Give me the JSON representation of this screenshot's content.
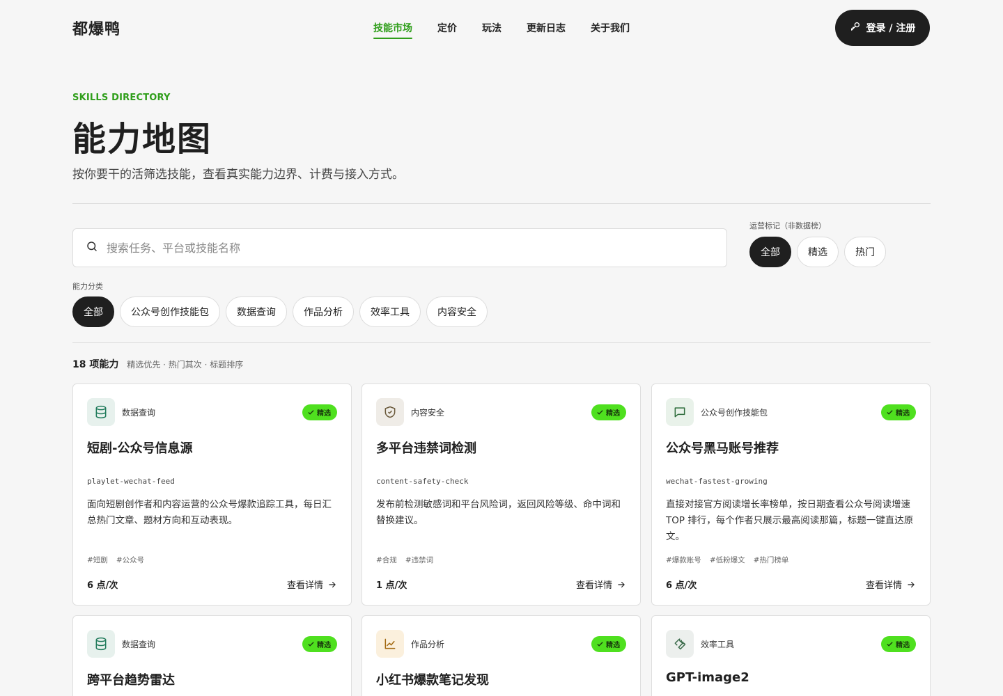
{
  "brand": {
    "logo": "都爆鸭",
    "accent": "#2f9e1a",
    "badge_color": "#4fe01f"
  },
  "nav": {
    "items": [
      {
        "label": "技能市场",
        "active": true
      },
      {
        "label": "定价"
      },
      {
        "label": "玩法"
      },
      {
        "label": "更新日志"
      },
      {
        "label": "关于我们"
      }
    ],
    "login_label": "登录 / 注册",
    "login_icon": "key-icon"
  },
  "hero": {
    "eyebrow": "SKILLS DIRECTORY",
    "title": "能力地图",
    "subtitle": "按你要干的活筛选技能，查看真实能力边界、计费与接入方式。"
  },
  "search": {
    "placeholder": "搜索任务、平台或技能名称",
    "value": ""
  },
  "ops_filter": {
    "label": "运营标记（非数据榜）",
    "options": [
      "全部",
      "精选",
      "热门"
    ],
    "selected": "全部"
  },
  "category_filter": {
    "label": "能力分类",
    "options": [
      "全部",
      "公众号创作技能包",
      "数据查询",
      "作品分析",
      "效率工具",
      "内容安全"
    ],
    "selected": "全部"
  },
  "results": {
    "count": "18 项能力",
    "sort_note": "精选优先 · 热门其次 · 标题排序"
  },
  "cards": [
    {
      "icon": "database-icon",
      "category": "数据查询",
      "badge": "精选",
      "title": "短剧-公众号信息源",
      "slug": "playlet-wechat-feed",
      "description": "面向短剧创作者和内容运营的公众号爆款追踪工具，每日汇总热门文章、题材方向和互动表现。",
      "tags": [
        "#短剧",
        "#公众号"
      ],
      "price": "6 点/次",
      "link": "查看详情"
    },
    {
      "icon": "shield-check-icon",
      "category": "内容安全",
      "badge": "精选",
      "title": "多平台违禁词检测",
      "slug": "content-safety-check",
      "description": "发布前检测敏感词和平台风险词，返回风险等级、命中词和替换建议。",
      "tags": [
        "#合规",
        "#违禁词"
      ],
      "price": "1 点/次",
      "link": "查看详情"
    },
    {
      "icon": "message-square-icon",
      "category": "公众号创作技能包",
      "badge": "精选",
      "title": "公众号黑马账号推荐",
      "slug": "wechat-fastest-growing",
      "description": "直接对接官方阅读增长率榜单，按日期查看公众号阅读增速 TOP 排行，每个作者只展示最高阅读那篇，标题一键直达原文。",
      "tags": [
        "#爆款账号",
        "#低粉爆文",
        "#热门榜单"
      ],
      "price": "6 点/次",
      "link": "查看详情"
    },
    {
      "icon": "database-icon",
      "category": "数据查询",
      "badge": "精选",
      "title": "跨平台趋势雷达"
    },
    {
      "icon": "line-chart-icon",
      "category": "作品分析",
      "badge": "精选",
      "title": "小红书爆款笔记发现"
    },
    {
      "icon": "wrench-icon",
      "category": "效率工具",
      "badge": "精选",
      "title": "GPT-image2"
    }
  ]
}
